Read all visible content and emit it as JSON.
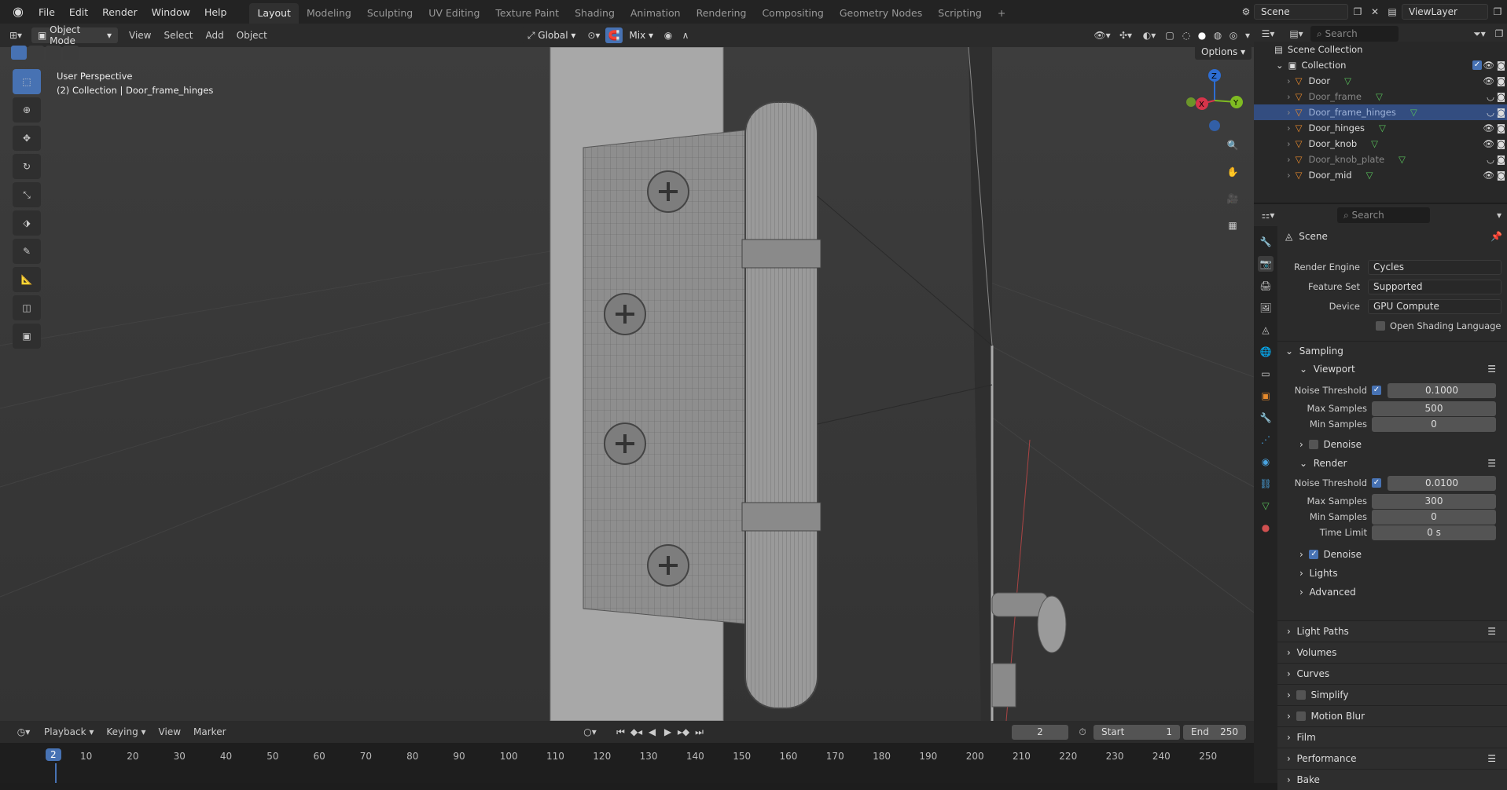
{
  "menu": [
    "File",
    "Edit",
    "Render",
    "Window",
    "Help"
  ],
  "workspaces": [
    "Layout",
    "Modeling",
    "Sculpting",
    "UV Editing",
    "Texture Paint",
    "Shading",
    "Animation",
    "Rendering",
    "Compositing",
    "Geometry Nodes",
    "Scripting"
  ],
  "active_workspace": "Layout",
  "scene_name": "Scene",
  "view_layer": "ViewLayer",
  "viewport_header": {
    "mode": "Object Mode",
    "menus": [
      "View",
      "Select",
      "Add",
      "Object"
    ],
    "transform": "Global",
    "blend": "Mix",
    "options_label": "Options"
  },
  "viewport_info": {
    "line1": "User Perspective",
    "line2": "(2) Collection | Door_frame_hinges"
  },
  "outliner": {
    "search_placeholder": "Search",
    "root": "Scene Collection",
    "collection": "Collection",
    "items": [
      {
        "name": "Door",
        "dim": false,
        "selected": false
      },
      {
        "name": "Door_frame",
        "dim": true,
        "selected": false
      },
      {
        "name": "Door_frame_hinges",
        "dim": true,
        "selected": true
      },
      {
        "name": "Door_hinges",
        "dim": false,
        "selected": false
      },
      {
        "name": "Door_knob",
        "dim": false,
        "selected": false
      },
      {
        "name": "Door_knob_plate",
        "dim": true,
        "selected": false
      },
      {
        "name": "Door_mid",
        "dim": false,
        "selected": false
      }
    ]
  },
  "properties": {
    "search_placeholder": "Search",
    "context": "Scene",
    "render_engine_label": "Render Engine",
    "render_engine": "Cycles",
    "feature_set_label": "Feature Set",
    "feature_set": "Supported",
    "device_label": "Device",
    "device": "GPU Compute",
    "osl_label": "Open Shading Language",
    "sampling": "Sampling",
    "viewport": "Viewport",
    "noise_threshold_label": "Noise Threshold",
    "viewport_noise": "0.1000",
    "max_samples_label": "Max Samples",
    "viewport_max": "500",
    "min_samples_label": "Min Samples",
    "viewport_min": "0",
    "denoise_label": "Denoise",
    "render": "Render",
    "render_noise": "0.0100",
    "render_max": "300",
    "render_min": "0",
    "time_limit_label": "Time Limit",
    "time_limit": "0 s",
    "lights": "Lights",
    "advanced": "Advanced",
    "sections": [
      "Light Paths",
      "Volumes",
      "Curves",
      "Simplify",
      "Motion Blur",
      "Film",
      "Performance",
      "Bake"
    ]
  },
  "timeline": {
    "menus": [
      "Playback",
      "Keying",
      "View",
      "Marker"
    ],
    "current_frame": "2",
    "start_label": "Start",
    "start": "1",
    "end_label": "End",
    "end": "250",
    "ruler": [
      "10",
      "20",
      "30",
      "40",
      "50",
      "60",
      "70",
      "80",
      "90",
      "100",
      "110",
      "120",
      "130",
      "140",
      "150",
      "160",
      "170",
      "180",
      "190",
      "200",
      "210",
      "220",
      "230",
      "240",
      "250"
    ],
    "playhead_label": "2"
  }
}
